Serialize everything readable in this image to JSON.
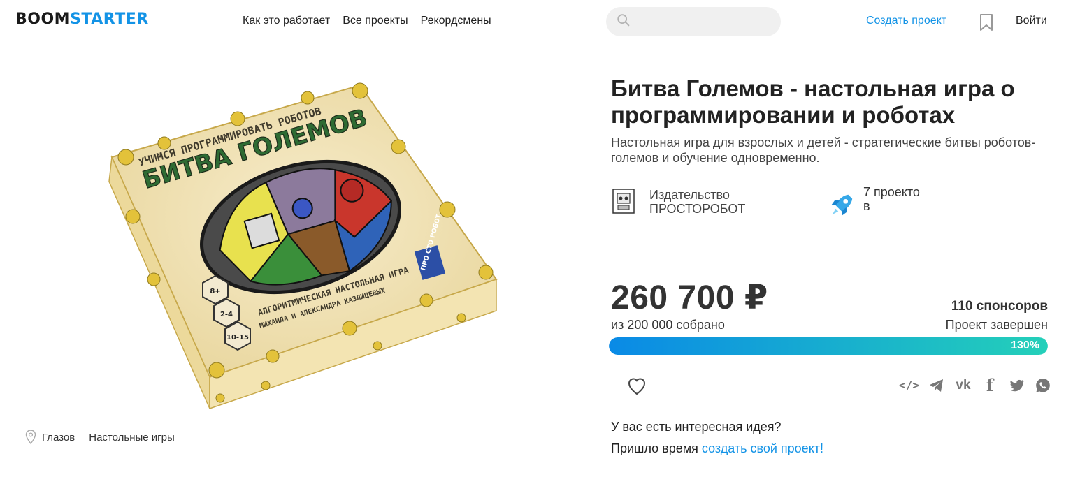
{
  "header": {
    "logo_boom": "BOOM",
    "logo_starter": "STARTER",
    "nav": [
      "Как это работает",
      "Все проекты",
      "Рекордсмены"
    ],
    "search_placeholder": "",
    "create_project": "Создать проект",
    "login": "Войти"
  },
  "project": {
    "title": "Битва Големов - настольная игра о программировании и роботах",
    "subtitle": "Настольная игра для взрослых и детей - стратегические битвы роботов-големов и обучение одновременно.",
    "author_label": "Издательство",
    "author_name": "ПРОСТОРОБОТ",
    "projects_count": "7 проектов",
    "amount": "260 700 ₽",
    "goal": "из 200 000 собрано",
    "sponsors": "110 спонсоров",
    "status": "Проект завершен",
    "progress_percent": 130,
    "progress_label": "130%",
    "location": "Глазов",
    "category": "Настольные игры",
    "box_text": {
      "top_line": "УЧИМСЯ ПРОГРАММИРОВАТЬ РОБОТОВ",
      "title": "БИТВА ГОЛЕМОВ",
      "bottom_line1": "АЛГОРИТМИЧЕСКАЯ НАСТОЛЬНАЯ ИГРА",
      "bottom_line2": "МИХАИЛА И АЛЕКСАНДРА КАЗЛИЦЕВЫХ",
      "age": "8+",
      "players": "2-4",
      "time": "10-15",
      "brand": "ПРО СТО РОБОТ"
    }
  },
  "footer": {
    "idea_question": "У вас есть интересная идея?",
    "cta_prefix": "Пришло время ",
    "cta_link": "создать свой проект!"
  },
  "share_icons": [
    "embed-icon",
    "telegram-icon",
    "vk-icon",
    "facebook-icon",
    "twitter-icon",
    "whatsapp-icon"
  ],
  "colors": {
    "accent": "#1393e6",
    "progress_start": "#0a8ae6",
    "progress_end": "#24d0b9"
  }
}
